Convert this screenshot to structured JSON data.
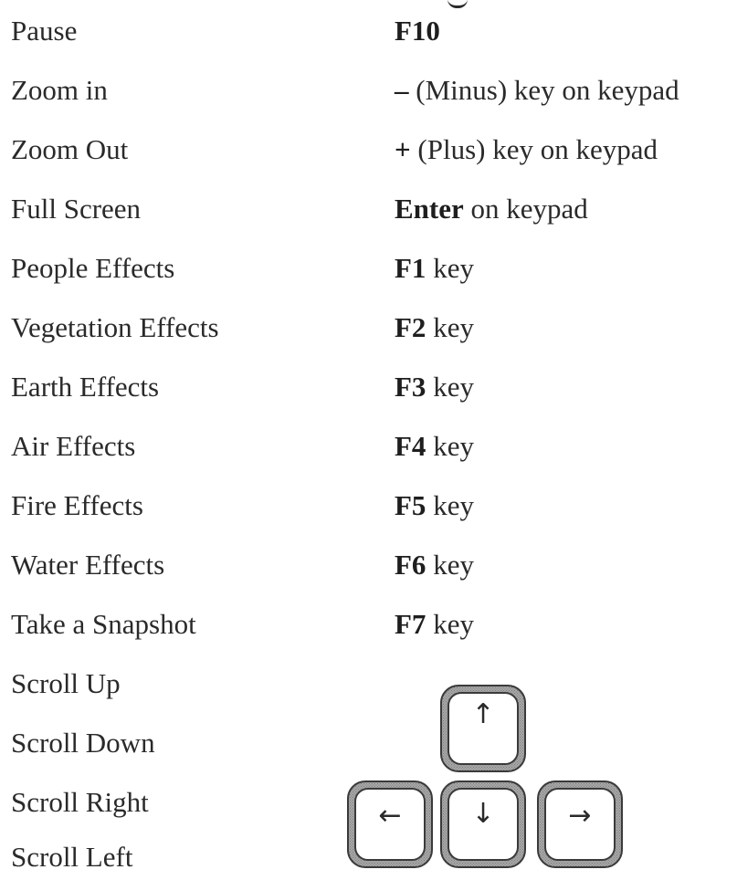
{
  "rows": [
    {
      "action": "Pause",
      "key": "F10",
      "suffix": ""
    },
    {
      "action": "Zoom in",
      "key": "–",
      "suffix": " (Minus) key on keypad"
    },
    {
      "action": "Zoom Out",
      "key": "+",
      "suffix": " (Plus) key on keypad"
    },
    {
      "action": "Full Screen",
      "key": "Enter",
      "suffix": " on keypad"
    },
    {
      "action": "People Effects",
      "key": "F1",
      "suffix": " key"
    },
    {
      "action": "Vegetation Effects",
      "key": "F2",
      "suffix": " key"
    },
    {
      "action": "Earth Effects",
      "key": "F3",
      "suffix": " key"
    },
    {
      "action": "Air Effects",
      "key": "F4",
      "suffix": " key"
    },
    {
      "action": "Fire Effects",
      "key": "F5",
      "suffix": " key"
    },
    {
      "action": "Water Effects",
      "key": "F6",
      "suffix": " key"
    },
    {
      "action": "Take a Snapshot",
      "key": "F7",
      "suffix": " key"
    },
    {
      "action": "Scroll Up"
    },
    {
      "action": "Scroll Down"
    },
    {
      "action": "Scroll Right"
    },
    {
      "action": "Scroll Left"
    }
  ],
  "arrow_keys": {
    "up": "↑",
    "left": "←",
    "down": "↓",
    "right": "→"
  }
}
